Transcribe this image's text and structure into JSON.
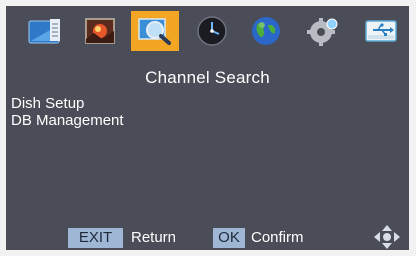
{
  "icons": [
    {
      "name": "tv-program-icon",
      "active": false
    },
    {
      "name": "picture-icon",
      "active": false
    },
    {
      "name": "channel-search-icon",
      "active": true
    },
    {
      "name": "clock-icon",
      "active": false
    },
    {
      "name": "globe-icon",
      "active": false
    },
    {
      "name": "settings-gear-icon",
      "active": false
    },
    {
      "name": "usb-icon",
      "active": false
    }
  ],
  "page": {
    "title": "Channel Search"
  },
  "menu": {
    "items": [
      "Dish Setup",
      "DB Management"
    ]
  },
  "footer": {
    "exit_key": "EXIT",
    "exit_label": "Return",
    "ok_key": "OK",
    "ok_label": "Confirm",
    "nav_icon": "move-arrows-icon"
  },
  "colors": {
    "background": "#4a4d57",
    "active_tile": "#f2a623",
    "keycap": "#9fb6d5",
    "text": "#ffffff"
  }
}
